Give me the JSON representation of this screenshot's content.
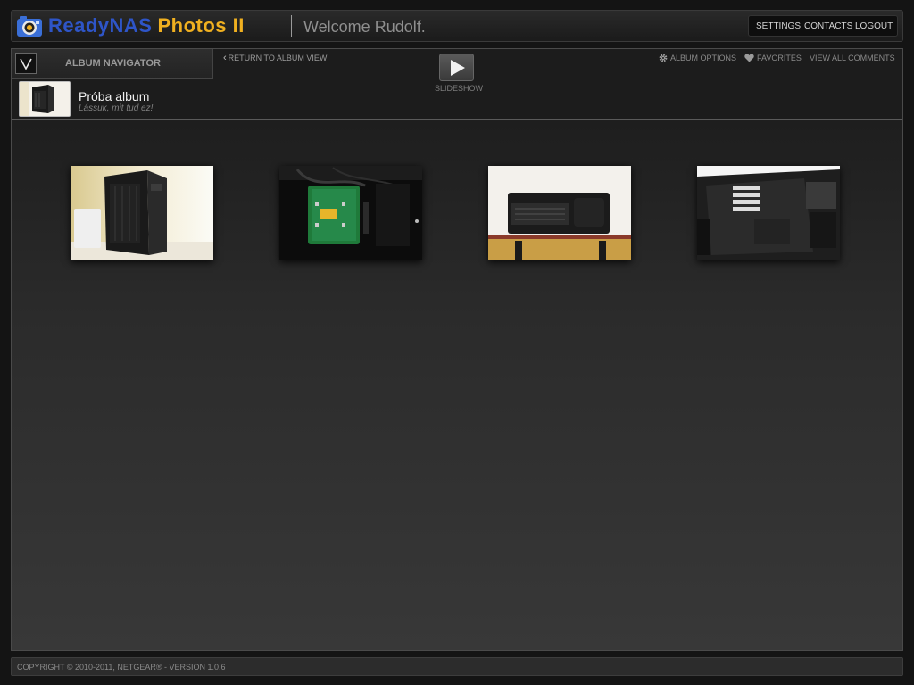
{
  "header": {
    "logo_icon": "camera-icon",
    "brand_name": "ReadyNAS",
    "brand_suffix": "Photos II",
    "welcome": "Welcome Rudolf.",
    "nav": {
      "settings": "SETTINGS",
      "contacts": "CONTACTS",
      "logout": "LOGOUT"
    }
  },
  "navigator": {
    "toggle_icon": "chevron-down-icon",
    "title": "ALBUM NAVIGATOR",
    "album": {
      "name": "Próba album",
      "description": "Lássuk, mit tud ez!"
    }
  },
  "toolbar": {
    "return_icon": "chevron-left-icon",
    "return_label": "RETURN TO ALBUM VIEW",
    "slideshow_icon": "play-icon",
    "slideshow_label": "SLIDESHOW",
    "album_options_icon": "gear-icon",
    "album_options_label": "ALBUM OPTIONS",
    "favorites_icon": "heart-icon",
    "favorites_label": "FAVORITES",
    "view_comments_label": "VIEW ALL COMMENTS"
  },
  "photos": [
    {
      "subject": "pc-case-side"
    },
    {
      "subject": "circuit-board"
    },
    {
      "subject": "pc-case-top"
    },
    {
      "subject": "pc-case-interior"
    }
  ],
  "footer": {
    "copyright": "COPYRIGHT © 2010-2011, NETGEAR® - VERSION 1.0.6"
  },
  "colors": {
    "brand_blue": "#2e55c8",
    "brand_gold": "#f0b020",
    "background": "#141414"
  }
}
